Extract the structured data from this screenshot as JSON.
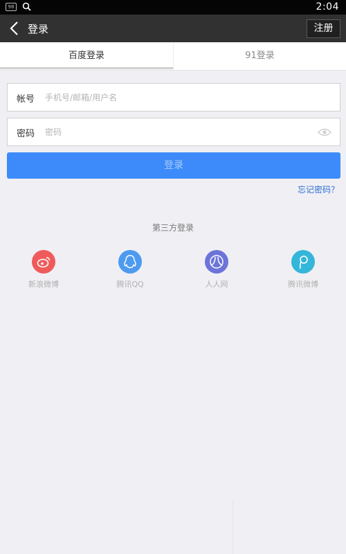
{
  "status": {
    "badge": "98",
    "time": "2:04"
  },
  "header": {
    "title": "登录",
    "register_label": "注册"
  },
  "tabs": [
    {
      "label": "百度登录",
      "active": true
    },
    {
      "label": "91登录",
      "active": false
    }
  ],
  "form": {
    "account_label": "帐号",
    "account_placeholder": "手机号/邮箱/用户名",
    "account_value": "",
    "password_label": "密码",
    "password_placeholder": "密码",
    "password_value": ""
  },
  "login_button": "登录",
  "forgot_password": "忘记密码？",
  "third_party": {
    "title": "第三方登录",
    "items": [
      {
        "label": "新浪微博",
        "icon": "weibo-icon",
        "color": "#ef5b5b"
      },
      {
        "label": "腾讯QQ",
        "icon": "qq-icon",
        "color": "#4d9bf0"
      },
      {
        "label": "人人网",
        "icon": "renren-icon",
        "color": "#6c74da"
      },
      {
        "label": "腾讯微博",
        "icon": "tencent-weibo-icon",
        "color": "#33b6d9"
      }
    ]
  },
  "colors": {
    "accent": "#3d8bfb",
    "titlebar": "#313131",
    "link": "#2a6fd4"
  }
}
